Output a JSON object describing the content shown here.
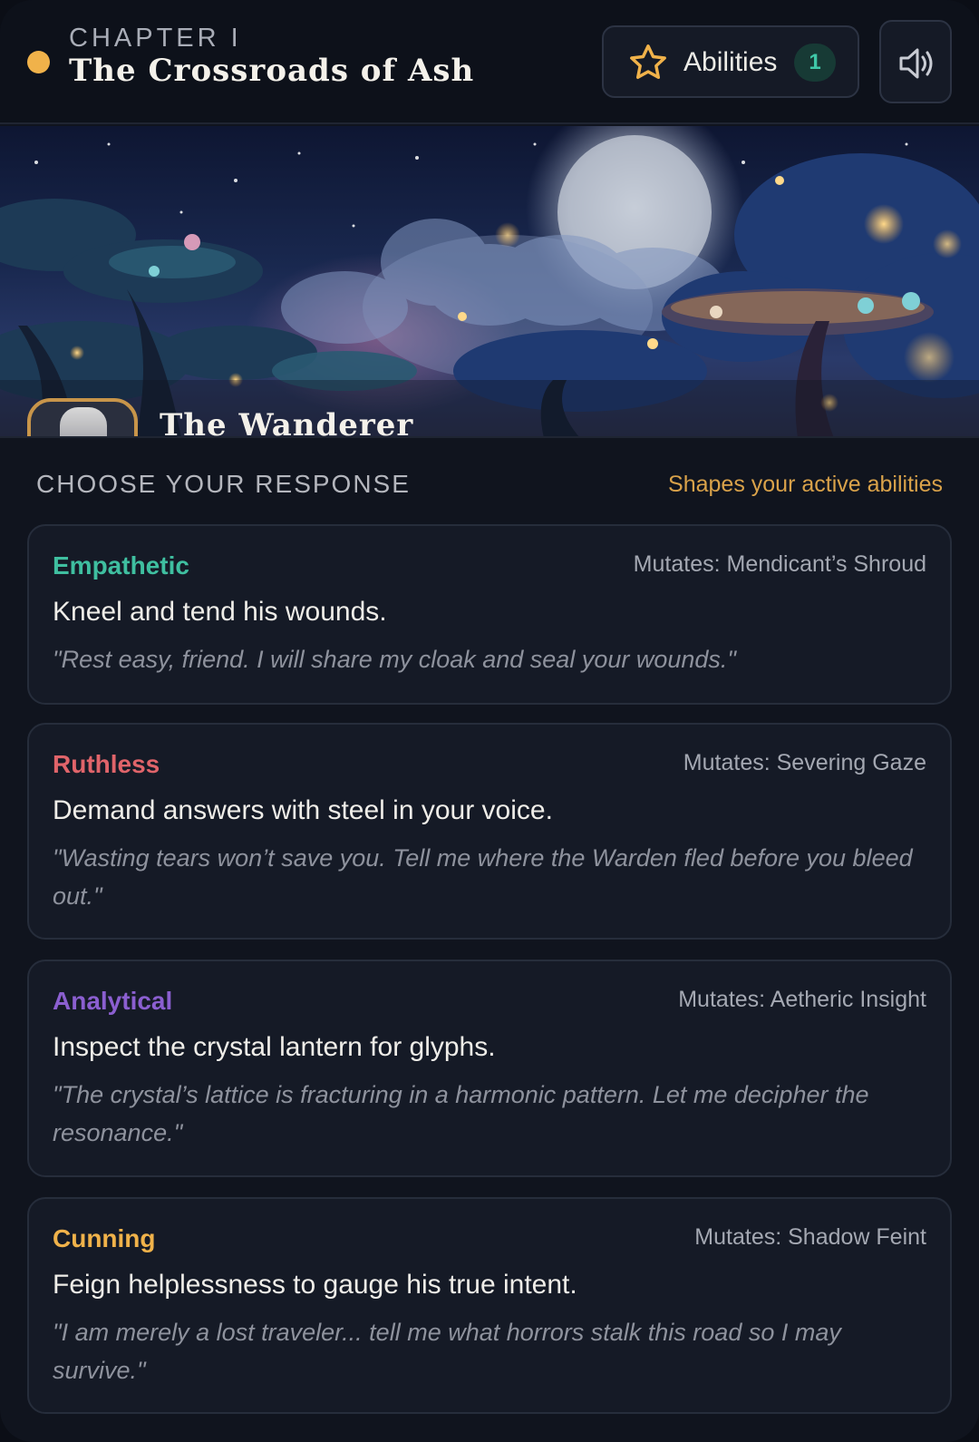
{
  "header": {
    "chapter_label": "CHAPTER I",
    "chapter_title": "The Crossroads of Ash",
    "abilities_label": "Abilities",
    "abilities_count": "1",
    "sound_icon": "speaker-icon",
    "star_icon": "star-icon"
  },
  "scene": {
    "npc_name": "The Wanderer"
  },
  "responses": {
    "title": "CHOOSE YOUR RESPONSE",
    "hint": "Shapes your active abilities",
    "options": [
      {
        "tone": "Empathetic",
        "tone_color": "#3fbfa0",
        "mutates": "Mutates: Mendicant’s Shroud",
        "action": "Kneel and tend his wounds.",
        "quote": "\"Rest easy, friend. I will share my cloak and seal your wounds.\""
      },
      {
        "tone": "Ruthless",
        "tone_color": "#e0646a",
        "mutates": "Mutates: Severing Gaze",
        "action": "Demand answers with steel in your voice.",
        "quote": "\"Wasting tears won’t save you. Tell me where the Warden fled before you bleed out.\""
      },
      {
        "tone": "Analytical",
        "tone_color": "#8b5fd0",
        "mutates": "Mutates: Aetheric Insight",
        "action": "Inspect the crystal lantern for glyphs.",
        "quote": "\"The crystal’s lattice is fracturing in a harmonic pattern. Let me decipher the resonance.\""
      },
      {
        "tone": "Cunning",
        "tone_color": "#f0b24a",
        "mutates": "Mutates: Shadow Feint",
        "action": "Feign helplessness to gauge his true intent.",
        "quote": "\"I am merely a lost traveler... tell me what horrors stalk this road so I may survive.\""
      }
    ]
  }
}
